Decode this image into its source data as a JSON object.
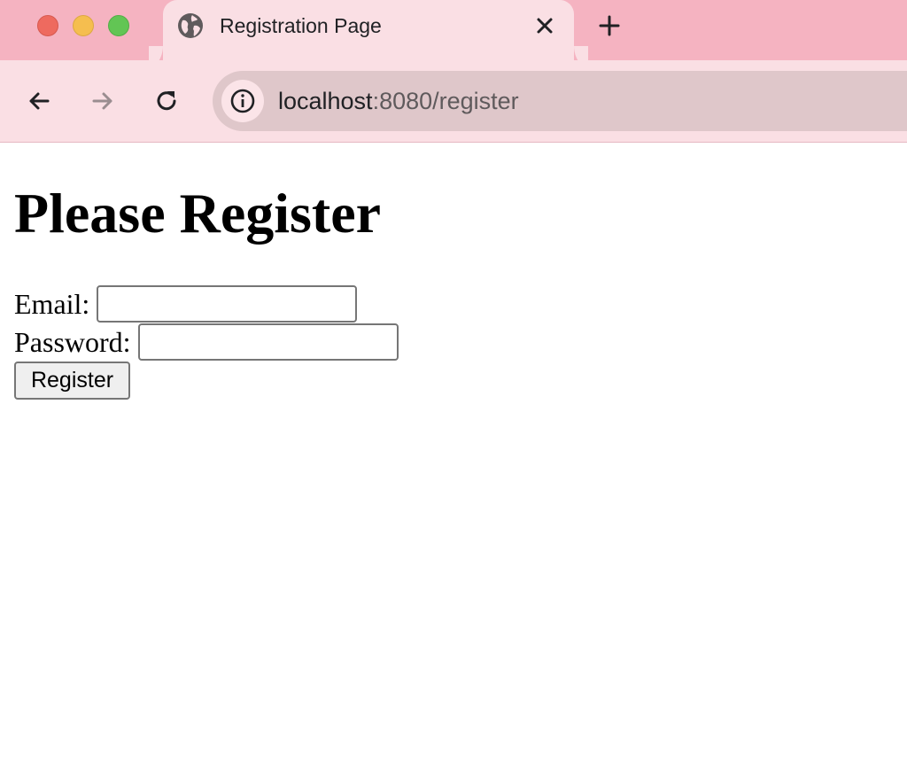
{
  "browser": {
    "tab_title": "Registration Page",
    "url_host": "localhost",
    "url_path": ":8080/register",
    "favicon": "globe-icon",
    "theme_colors": {
      "tabstrip": "#f5b3c1",
      "active_tab": "#fadfe4",
      "omnibox": "#dfc7ca"
    }
  },
  "page": {
    "heading": "Please Register",
    "email_label": "Email:",
    "email_value": "",
    "password_label": "Password:",
    "password_value": "",
    "submit_label": "Register"
  }
}
